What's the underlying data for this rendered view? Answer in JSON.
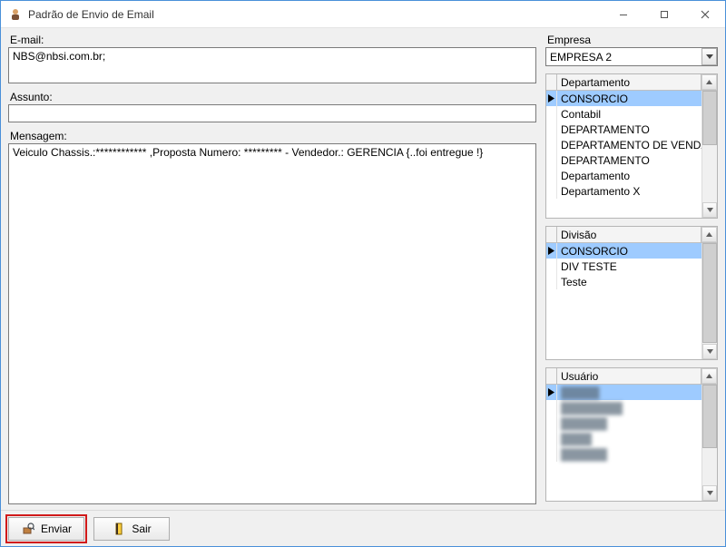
{
  "window": {
    "title": "Padrão de Envio de Email"
  },
  "labels": {
    "email": "E-mail:",
    "assunto": "Assunto:",
    "mensagem": "Mensagem:",
    "empresa": "Empresa",
    "departamento": "Departamento",
    "divisao": "Divisão",
    "usuario": "Usuário"
  },
  "fields": {
    "email_value": "NBS@nbsi.com.br;",
    "assunto_value": "",
    "mensagem_value": "Veiculo Chassis.:************ ,Proposta Numero: ********* - Vendedor.: GERENCIA {..foi entregue !}"
  },
  "empresa": {
    "selected": "EMPRESA 2"
  },
  "departamentos": {
    "selected_index": 0,
    "items": [
      "CONSORCIO",
      "Contabil",
      "DEPARTAMENTO",
      "DEPARTAMENTO DE VENDAS",
      "DEPARTAMENTO",
      "Departamento",
      "Departamento X"
    ]
  },
  "divisoes": {
    "selected_index": 0,
    "items": [
      "CONSORCIO",
      "DIV TESTE",
      "Teste"
    ]
  },
  "usuarios": {
    "selected_index": 0,
    "items": [
      "█████",
      "████████",
      "██████",
      "████",
      "██████"
    ]
  },
  "buttons": {
    "enviar": "Enviar",
    "sair": "Sair"
  }
}
